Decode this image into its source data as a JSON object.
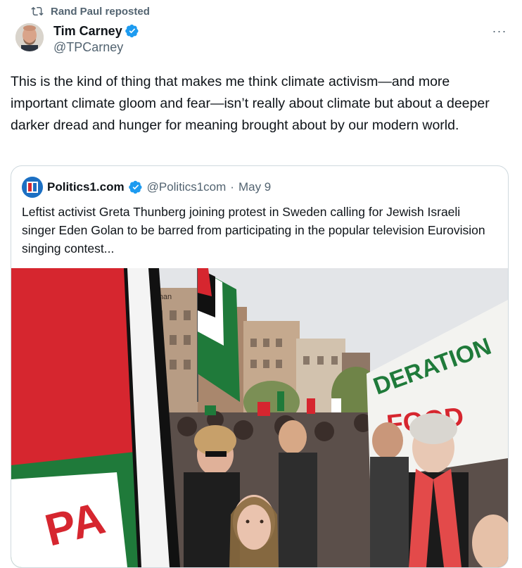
{
  "repost": {
    "label": "Rand Paul reposted",
    "icon": "repost-icon"
  },
  "author": {
    "name": "Tim Carney",
    "handle": "@TPCarney",
    "verified": true
  },
  "more_label": "···",
  "tweet": {
    "text": "This is the kind of thing that makes me think climate activism—and more important climate gloom and fear—isn’t really about climate but about a deeper darker dread and hunger for meaning brought about by our modern world."
  },
  "quote": {
    "name": "Politics1.com",
    "handle": "@Politics1com",
    "separator": "·",
    "date": "May 9",
    "text": "Leftist activist Greta Thunberg joining protest in Sweden calling for Jewish Israeli singer Eden Golan to be barred from participating in the popular television  Eurovision singing contest...",
    "image_text": {
      "banner": "DERATION",
      "banner_line2": "FOOD",
      "flag_text": "PA",
      "storefront": "ronan"
    }
  },
  "colors": {
    "verified_blue": "#1d9bf0",
    "muted": "#536471",
    "border": "#cfd9de",
    "flag_red": "#d6262f",
    "flag_green": "#1f7a3a"
  }
}
